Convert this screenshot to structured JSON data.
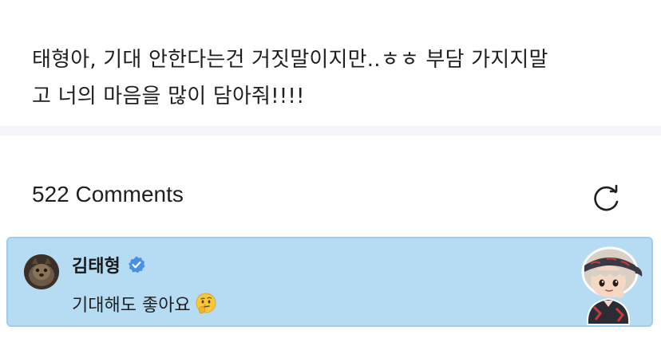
{
  "post": {
    "line1": "태형아, 기대 안한다는건 거짓말이지만..ㅎㅎ 부담 가지지말",
    "line2": "고 너의 마음을 많이 담아줘!!!!"
  },
  "comments": {
    "count_label": "522 Comments",
    "refresh_icon": "refresh-icon"
  },
  "comment": {
    "author": "김태형",
    "text": "기대해도 좋아요",
    "verified_icon": "verified-badge-icon",
    "emoji": "thinking-face-emoji",
    "highlight_color": "#b5dcf3",
    "badge_color": "#4a90e2"
  }
}
